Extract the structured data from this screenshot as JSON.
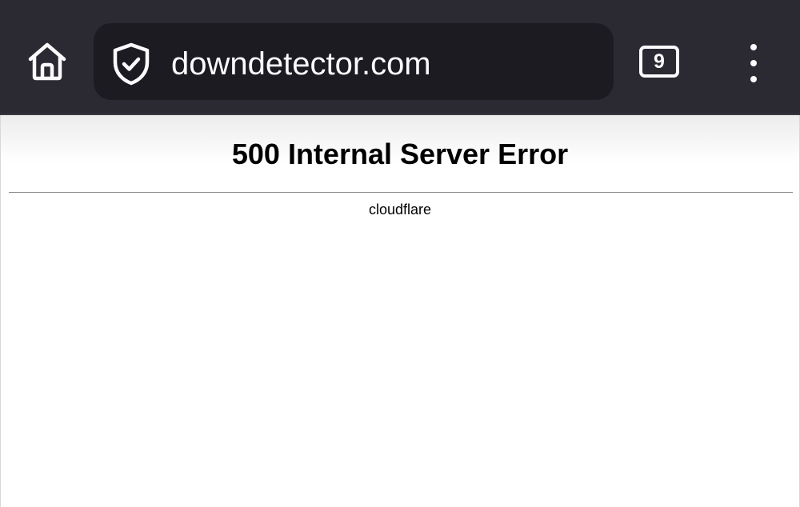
{
  "browser": {
    "url": "downdetector.com",
    "tab_count": "9",
    "icons": {
      "home": "home-icon",
      "security": "shield-check-icon",
      "tabs": "tab-counter-icon",
      "menu": "more-vertical-icon"
    },
    "colors": {
      "toolbar": "#2b2a33",
      "urlbar": "#1c1b22",
      "foreground": "#fbfbfe"
    }
  },
  "page": {
    "title": "500 Internal Server Error",
    "server": "cloudflare"
  }
}
